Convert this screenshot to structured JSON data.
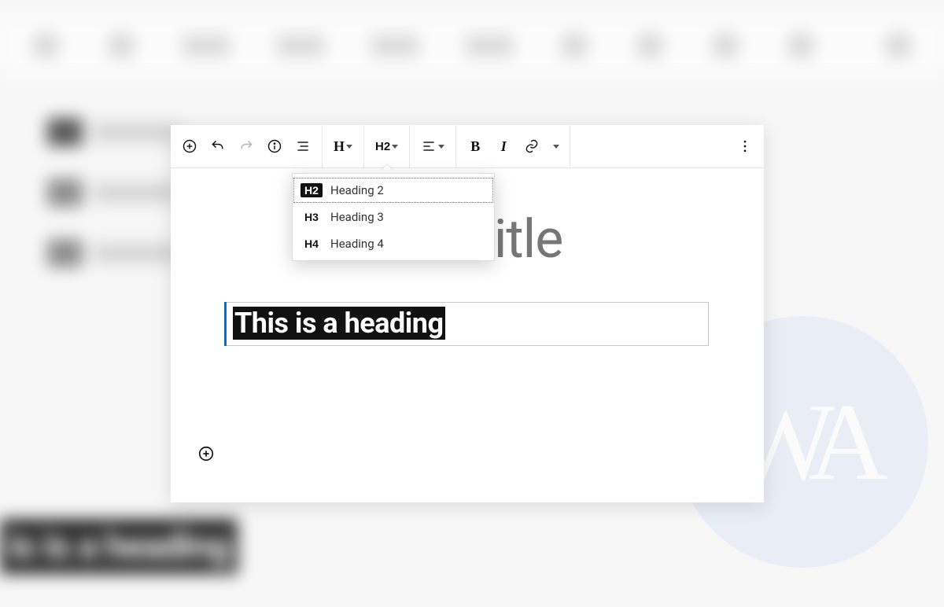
{
  "toolbar": {
    "block_type_label": "H",
    "heading_level_label": "H2"
  },
  "dropdown": {
    "items": [
      {
        "badge": "H2",
        "label": "Heading 2",
        "selected": true
      },
      {
        "badge": "H3",
        "label": "Heading 3",
        "selected": false
      },
      {
        "badge": "H4",
        "label": "Heading 4",
        "selected": false
      }
    ]
  },
  "content": {
    "title_placeholder": "Add title",
    "heading_text": "This is a heading"
  },
  "ghost": {
    "selected_heading_text": "is is a heading"
  },
  "watermark": {
    "text": "WA"
  }
}
